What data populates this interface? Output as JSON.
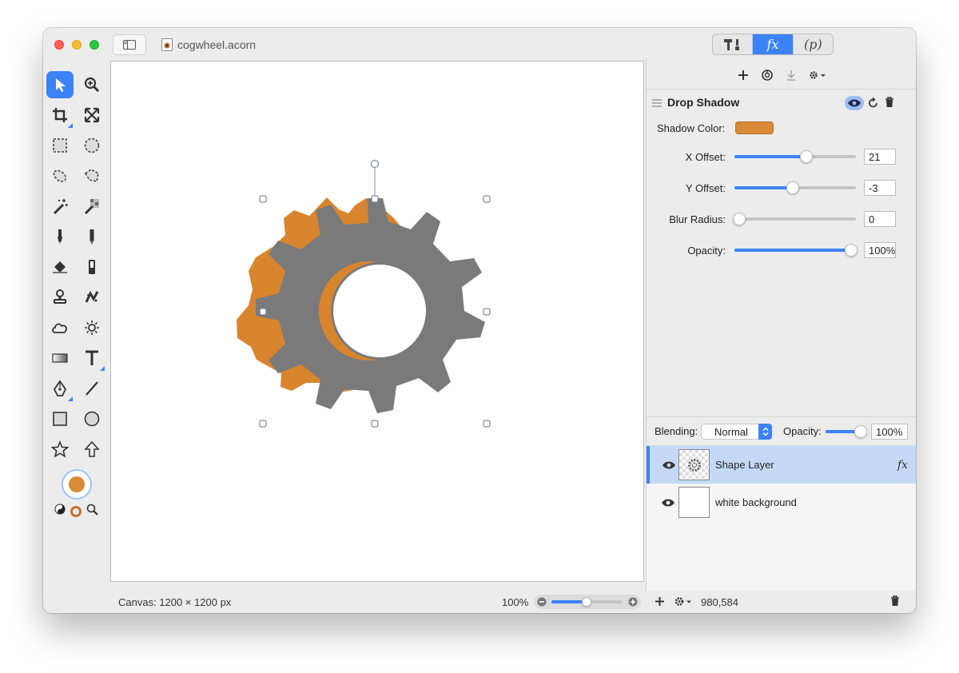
{
  "window": {
    "doc_name": "cogwheel.acorn",
    "segments": [
      {
        "name": "tools",
        "label": "⚒"
      },
      {
        "name": "fx",
        "label": "fx"
      },
      {
        "name": "p",
        "label": "(p)"
      }
    ]
  },
  "filter": {
    "name": "Drop Shadow",
    "shadow_color_label": "Shadow Color:",
    "shadow_color": "#d98a36",
    "x_offset": {
      "label": "X Offset:",
      "value": "21",
      "fraction": 0.59
    },
    "y_offset": {
      "label": "Y Offset:",
      "value": "-3",
      "fraction": 0.48
    },
    "blur_radius": {
      "label": "Blur Radius:",
      "value": "0",
      "fraction": 0.0
    },
    "opacity": {
      "label": "Opacity:",
      "value": "100%",
      "fraction": 1.0
    }
  },
  "blending": {
    "label": "Blending:",
    "mode": "Normal",
    "opacity_label": "Opacity:",
    "opacity_value": "100%",
    "opacity_fraction": 1.0
  },
  "layers": [
    {
      "name": "Shape Layer",
      "fx": "fx",
      "selected": true
    },
    {
      "name": "white background",
      "fx": "",
      "selected": false
    }
  ],
  "status": {
    "canvas_info": "Canvas: 1200 × 1200 px",
    "zoom": "100%",
    "zoom_fraction": 0.5,
    "coords": "980,584"
  },
  "colors": {
    "accent": "#3b82f6",
    "gear": "#7a7a7a",
    "shadow": "#d98a36",
    "foreground_swatch": "#d98a36"
  }
}
